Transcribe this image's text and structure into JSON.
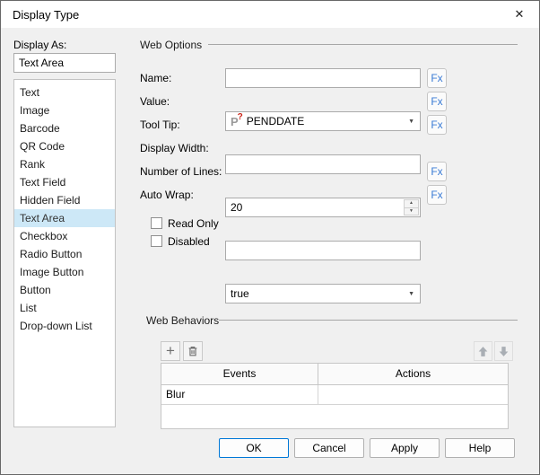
{
  "window": {
    "title": "Display Type"
  },
  "icons": {
    "close": "✕",
    "add": "+",
    "combo_arrow": "▼",
    "spin_up": "▲",
    "spin_down": "▼",
    "param_letter": "P",
    "param_mark": "?"
  },
  "display_as": {
    "label": "Display As:",
    "value": "Text Area"
  },
  "type_list": {
    "items": [
      "Text",
      "Image",
      "Barcode",
      "QR Code",
      "Rank",
      "Text Field",
      "Hidden Field",
      "Text Area",
      "Checkbox",
      "Radio Button",
      "Image Button",
      "Button",
      "List",
      "Drop-down List"
    ],
    "selected": "Text Area"
  },
  "web_options": {
    "title": "Web Options",
    "fx_label": "Fx",
    "name": {
      "label": "Name:",
      "value": ""
    },
    "value": {
      "label": "Value:",
      "value": "PENDDATE"
    },
    "tool_tip": {
      "label": "Tool Tip:",
      "value": ""
    },
    "display_width": {
      "label": "Display Width:",
      "value": "20"
    },
    "number_of_lines": {
      "label": "Number of Lines:",
      "value": ""
    },
    "auto_wrap": {
      "label": "Auto Wrap:",
      "value": "true"
    },
    "read_only": {
      "label": "Read Only",
      "checked": false
    },
    "disabled": {
      "label": "Disabled",
      "checked": false
    }
  },
  "web_behaviors": {
    "title": "Web Behaviors",
    "columns": {
      "events": "Events",
      "actions": "Actions"
    },
    "rows": [
      {
        "event": "Blur",
        "action": ""
      }
    ]
  },
  "footer": {
    "ok": "OK",
    "cancel": "Cancel",
    "apply": "Apply",
    "help": "Help"
  },
  "colors": {
    "accent": "#0078d7",
    "fx_blue": "#3a7bd5",
    "selection": "#cde8f7"
  }
}
